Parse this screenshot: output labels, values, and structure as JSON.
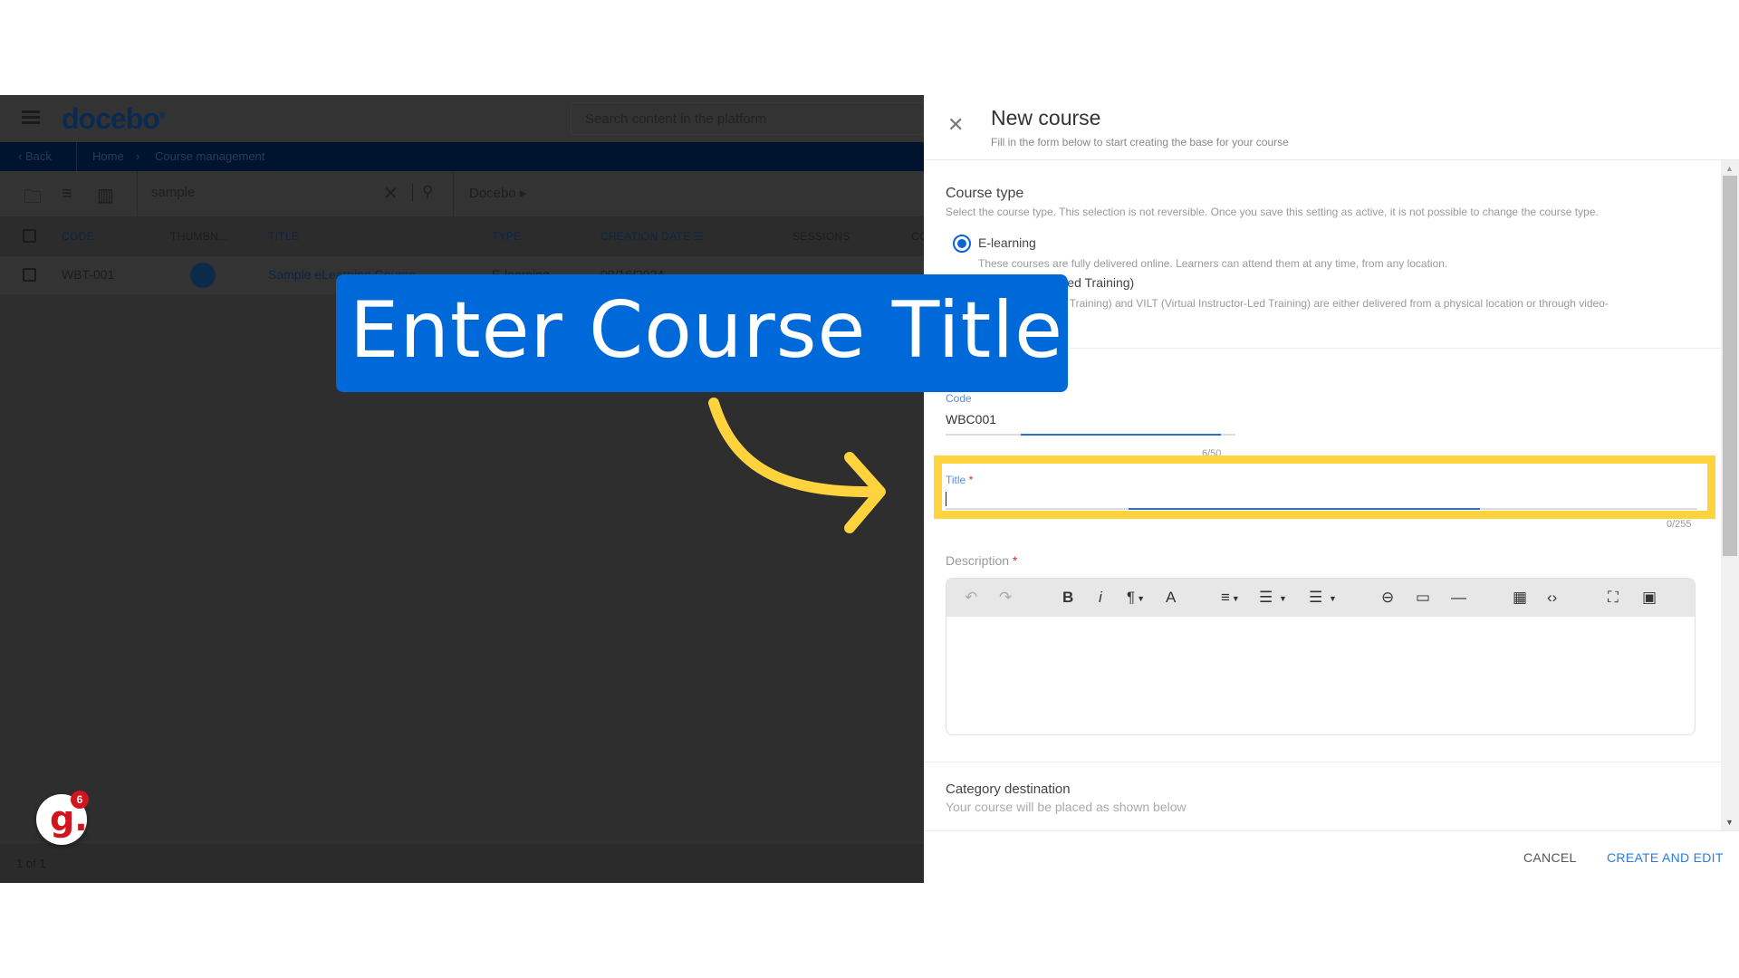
{
  "app": {
    "logo": "docebo",
    "global_search_placeholder": "Search content in the platform",
    "breadcrumb": {
      "back": "Back",
      "home": "Home",
      "separator": "›",
      "current": "Course management"
    },
    "toolbar": {
      "filter_value": "sample",
      "scope": "Docebo",
      "scope_chevron": "▸",
      "icons": [
        "folder-icon",
        "filter-icon",
        "columns-icon",
        "clear-icon",
        "search-icon"
      ]
    },
    "table": {
      "columns": [
        "CODE",
        "THUMBN...",
        "TITLE",
        "TYPE",
        "CREATION DATE",
        "SESSIONS",
        "CO"
      ],
      "rows": [
        {
          "code": "WBT-001",
          "title": "Sample eLearning Course",
          "type": "E-learning",
          "creation_date": "09/16/2024"
        }
      ]
    },
    "pager": "1 of 1",
    "guide_badge": {
      "letter": "g.",
      "count": "6",
      "color": "#d4141c"
    }
  },
  "callout": {
    "text": "Enter Course Title",
    "bg_color": "#0069d9",
    "arrow_color": "#ffd33d"
  },
  "panel": {
    "title": "New course",
    "subtitle": "Fill in the form below to start creating the base for your course",
    "course_type": {
      "title": "Course type",
      "subtitle": "Select the course type. This selection is not reversible. Once you save this setting as active, it is not possible to change the course type.",
      "options": [
        {
          "label": "E-learning",
          "desc": "These courses are fully delivered online. Learners can attend them at any time, from any location.",
          "selected": true
        },
        {
          "label": "ILT (Instructor-Led Training)",
          "desc": "ILT (Instructor-Led Training) and VILT (Virtual Instructor-Led Training) are either delivered from a physical location or through video-",
          "selected": false
        }
      ]
    },
    "code_field": {
      "label": "Code",
      "value": "WBC001",
      "counter": "6/50"
    },
    "title_field": {
      "label": "Title",
      "required": "*",
      "value": "",
      "counter": "0/255"
    },
    "description": {
      "label": "Description",
      "required": "*"
    },
    "editor_toolbar": [
      "undo",
      "redo",
      "bold",
      "italic",
      "paragraph-format",
      "text-color",
      "align",
      "ordered-list",
      "unordered-list",
      "link",
      "video",
      "horizontal-line",
      "table",
      "code-view",
      "fullscreen",
      "image"
    ],
    "category": {
      "title": "Category destination",
      "subtitle": "Your course will be placed as shown below"
    },
    "buttons": {
      "cancel": "CANCEL",
      "create": "CREATE AND EDIT"
    }
  }
}
